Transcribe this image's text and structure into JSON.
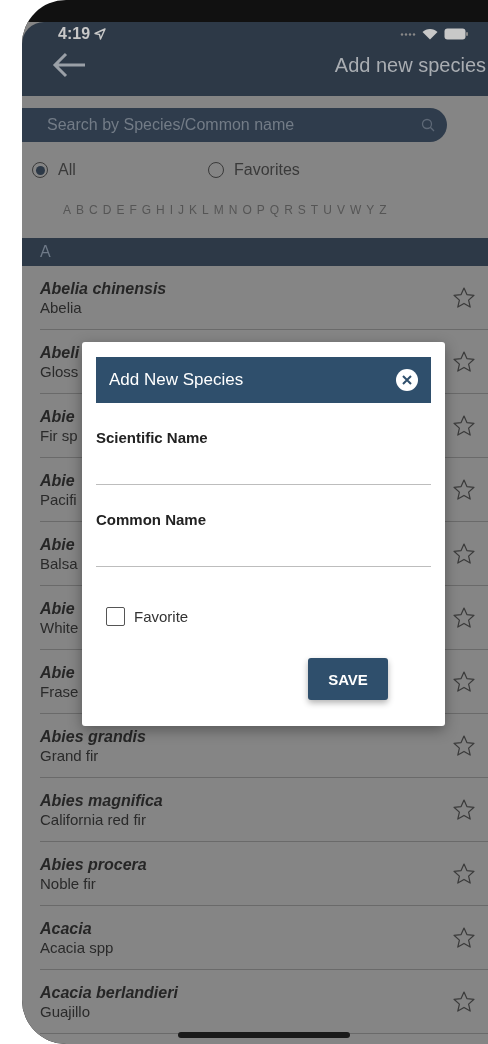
{
  "status_bar": {
    "time": "4:19"
  },
  "nav_bar": {
    "title": "Add new species"
  },
  "search": {
    "placeholder": "Search by Species/Common name"
  },
  "filters": [
    {
      "label": "All",
      "selected": true
    },
    {
      "label": "Favorites",
      "selected": false
    }
  ],
  "alphabet": [
    "A",
    "B",
    "C",
    "D",
    "E",
    "F",
    "G",
    "H",
    "I",
    "J",
    "K",
    "L",
    "M",
    "N",
    "O",
    "P",
    "Q",
    "R",
    "S",
    "T",
    "U",
    "V",
    "W",
    "Y",
    "Z"
  ],
  "section": {
    "title": "A"
  },
  "species": [
    {
      "scientific": "Abelia chinensis",
      "common": "Abelia",
      "favorite": false
    },
    {
      "scientific": "Abeli",
      "common": "Gloss",
      "favorite": false
    },
    {
      "scientific": "Abie",
      "common": "Fir sp",
      "favorite": false
    },
    {
      "scientific": "Abie",
      "common": "Pacifi",
      "favorite": false
    },
    {
      "scientific": "Abie",
      "common": "Balsa",
      "favorite": false
    },
    {
      "scientific": "Abie",
      "common": "White",
      "favorite": false
    },
    {
      "scientific": "Abie",
      "common": "Frase",
      "favorite": false
    },
    {
      "scientific": "Abies grandis",
      "common": "Grand fir",
      "favorite": false
    },
    {
      "scientific": "Abies magnifica",
      "common": "California red fir",
      "favorite": false
    },
    {
      "scientific": "Abies procera",
      "common": "Noble fir",
      "favorite": false
    },
    {
      "scientific": "Acacia",
      "common": "Acacia spp",
      "favorite": false
    },
    {
      "scientific": "Acacia berlandieri",
      "common": "Guajillo",
      "favorite": false
    }
  ],
  "dialog": {
    "title": "Add New Species",
    "fields": [
      {
        "label": "Scientific Name"
      },
      {
        "label": "Common Name"
      }
    ],
    "favorite": {
      "label": "Favorite",
      "checked": false
    },
    "save": "SAVE"
  }
}
